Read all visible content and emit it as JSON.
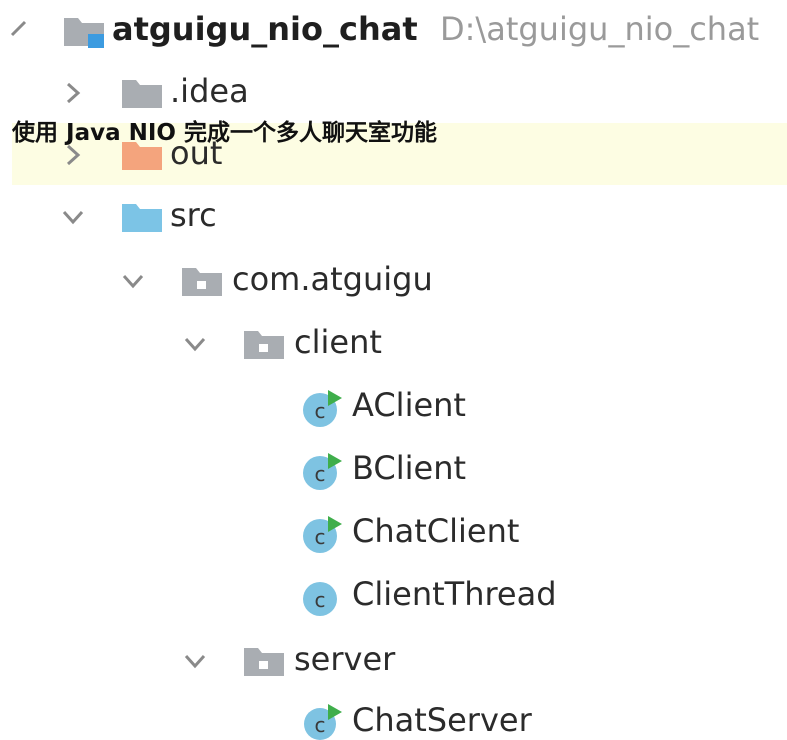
{
  "project": {
    "name": "atguigu_nio_chat",
    "path": "D:\\atguigu_nio_chat"
  },
  "caption": "使用 Java NIO 完成一个多人聊天室功能",
  "tree": {
    "idea": ".idea",
    "out": "out",
    "src": "src",
    "package": "com.atguigu",
    "client_pkg": "client",
    "client_classes": [
      "AClient",
      "BClient",
      "ChatClient",
      "ClientThread"
    ],
    "server_pkg": "server",
    "server_classes": [
      "ChatServer"
    ]
  },
  "colors": {
    "highlight": "#fdfde3",
    "folder_grey": "#a9adb2",
    "folder_orange": "#f4a47d",
    "folder_blue": "#7cc4e6",
    "class_circle": "#7ec3e2",
    "run_green": "#3fae4b",
    "module_mark": "#3c9be0"
  },
  "icons": {
    "collapsed": "chevron-right-icon",
    "expanded": "chevron-down-icon",
    "module": "module-folder-icon",
    "folder": "folder-icon",
    "package": "package-icon",
    "class": "java-class-icon",
    "runnable_class": "runnable-class-icon"
  }
}
